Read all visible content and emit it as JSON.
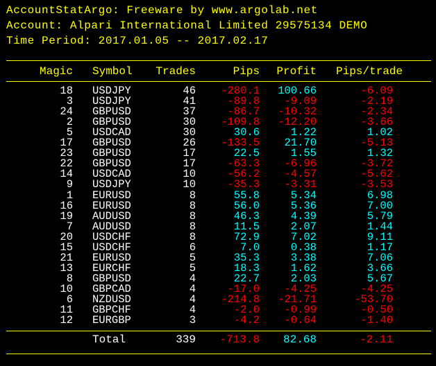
{
  "header": {
    "line1": "AccountStatArgo: Freeware by www.argolab.net",
    "line2": "Account: Alpari International Limited 29575134 DEMO",
    "line3": "Time Period: 2017.01.05 -- 2017.02.17"
  },
  "columns": [
    "Magic",
    "Symbol",
    "Trades",
    "Pips",
    "Profit",
    "Pips/trade"
  ],
  "colors": {
    "background": "#000000",
    "header_text": "#ffff00",
    "table_text": "#ffffff",
    "positive": "#00ffff",
    "negative": "#ff0000"
  },
  "rows": [
    {
      "magic": "18",
      "symbol": "USDJPY",
      "trades": "46",
      "pips": "-280.1",
      "profit": "100.66",
      "pips_per_trade": "-6.09",
      "pips_sign": "neg",
      "profit_sign": "pos",
      "ppt_sign": "neg"
    },
    {
      "magic": "3",
      "symbol": "USDJPY",
      "trades": "41",
      "pips": "-89.8",
      "profit": "-9.09",
      "pips_per_trade": "-2.19",
      "pips_sign": "neg",
      "profit_sign": "neg",
      "ppt_sign": "neg"
    },
    {
      "magic": "24",
      "symbol": "GBPUSD",
      "trades": "37",
      "pips": "-86.7",
      "profit": "-10.32",
      "pips_per_trade": "-2.34",
      "pips_sign": "neg",
      "profit_sign": "neg",
      "ppt_sign": "neg"
    },
    {
      "magic": "2",
      "symbol": "GBPUSD",
      "trades": "30",
      "pips": "-109.8",
      "profit": "-12.20",
      "pips_per_trade": "-3.66",
      "pips_sign": "neg",
      "profit_sign": "neg",
      "ppt_sign": "neg"
    },
    {
      "magic": "5",
      "symbol": "USDCAD",
      "trades": "30",
      "pips": "30.6",
      "profit": "1.22",
      "pips_per_trade": "1.02",
      "pips_sign": "pos",
      "profit_sign": "pos",
      "ppt_sign": "pos"
    },
    {
      "magic": "17",
      "symbol": "GBPUSD",
      "trades": "26",
      "pips": "-133.5",
      "profit": "21.70",
      "pips_per_trade": "-5.13",
      "pips_sign": "neg",
      "profit_sign": "pos",
      "ppt_sign": "neg"
    },
    {
      "magic": "23",
      "symbol": "GBPUSD",
      "trades": "17",
      "pips": "22.5",
      "profit": "1.55",
      "pips_per_trade": "1.32",
      "pips_sign": "pos",
      "profit_sign": "pos",
      "ppt_sign": "pos"
    },
    {
      "magic": "22",
      "symbol": "GBPUSD",
      "trades": "17",
      "pips": "-63.3",
      "profit": "-6.96",
      "pips_per_trade": "-3.72",
      "pips_sign": "neg",
      "profit_sign": "neg",
      "ppt_sign": "neg"
    },
    {
      "magic": "14",
      "symbol": "USDCAD",
      "trades": "10",
      "pips": "-56.2",
      "profit": "-4.57",
      "pips_per_trade": "-5.62",
      "pips_sign": "neg",
      "profit_sign": "neg",
      "ppt_sign": "neg"
    },
    {
      "magic": "9",
      "symbol": "USDJPY",
      "trades": "10",
      "pips": "-35.3",
      "profit": "-3.31",
      "pips_per_trade": "-3.53",
      "pips_sign": "neg",
      "profit_sign": "neg",
      "ppt_sign": "neg"
    },
    {
      "magic": "1",
      "symbol": "EURUSD",
      "trades": "8",
      "pips": "55.8",
      "profit": "5.34",
      "pips_per_trade": "6.98",
      "pips_sign": "pos",
      "profit_sign": "pos",
      "ppt_sign": "pos"
    },
    {
      "magic": "16",
      "symbol": "EURUSD",
      "trades": "8",
      "pips": "56.0",
      "profit": "5.36",
      "pips_per_trade": "7.00",
      "pips_sign": "pos",
      "profit_sign": "pos",
      "ppt_sign": "pos"
    },
    {
      "magic": "19",
      "symbol": "AUDUSD",
      "trades": "8",
      "pips": "46.3",
      "profit": "4.39",
      "pips_per_trade": "5.79",
      "pips_sign": "pos",
      "profit_sign": "pos",
      "ppt_sign": "pos"
    },
    {
      "magic": "7",
      "symbol": "AUDUSD",
      "trades": "8",
      "pips": "11.5",
      "profit": "2.07",
      "pips_per_trade": "1.44",
      "pips_sign": "pos",
      "profit_sign": "pos",
      "ppt_sign": "pos"
    },
    {
      "magic": "20",
      "symbol": "USDCHF",
      "trades": "8",
      "pips": "72.9",
      "profit": "7.02",
      "pips_per_trade": "9.11",
      "pips_sign": "pos",
      "profit_sign": "pos",
      "ppt_sign": "pos"
    },
    {
      "magic": "15",
      "symbol": "USDCHF",
      "trades": "6",
      "pips": "7.0",
      "profit": "0.38",
      "pips_per_trade": "1.17",
      "pips_sign": "pos",
      "profit_sign": "pos",
      "ppt_sign": "pos"
    },
    {
      "magic": "21",
      "symbol": "EURUSD",
      "trades": "5",
      "pips": "35.3",
      "profit": "3.38",
      "pips_per_trade": "7.06",
      "pips_sign": "pos",
      "profit_sign": "pos",
      "ppt_sign": "pos"
    },
    {
      "magic": "13",
      "symbol": "EURCHF",
      "trades": "5",
      "pips": "18.3",
      "profit": "1.62",
      "pips_per_trade": "3.66",
      "pips_sign": "pos",
      "profit_sign": "pos",
      "ppt_sign": "pos"
    },
    {
      "magic": "8",
      "symbol": "GBPUSD",
      "trades": "4",
      "pips": "22.7",
      "profit": "2.03",
      "pips_per_trade": "5.67",
      "pips_sign": "pos",
      "profit_sign": "pos",
      "ppt_sign": "pos"
    },
    {
      "magic": "10",
      "symbol": "GBPCAD",
      "trades": "4",
      "pips": "-17.0",
      "profit": "-4.25",
      "pips_per_trade": "-4.25",
      "pips_sign": "neg",
      "profit_sign": "neg",
      "ppt_sign": "neg"
    },
    {
      "magic": "6",
      "symbol": "NZDUSD",
      "trades": "4",
      "pips": "-214.8",
      "profit": "-21.71",
      "pips_per_trade": "-53.70",
      "pips_sign": "neg",
      "profit_sign": "neg",
      "ppt_sign": "neg"
    },
    {
      "magic": "11",
      "symbol": "GBPCHF",
      "trades": "4",
      "pips": "-2.0",
      "profit": "-0.99",
      "pips_per_trade": "-0.50",
      "pips_sign": "neg",
      "profit_sign": "neg",
      "ppt_sign": "neg"
    },
    {
      "magic": "12",
      "symbol": "EURGBP",
      "trades": "3",
      "pips": "-4.2",
      "profit": "-0.64",
      "pips_per_trade": "-1.40",
      "pips_sign": "neg",
      "profit_sign": "neg",
      "ppt_sign": "neg"
    }
  ],
  "total": {
    "label": "Total",
    "trades": "339",
    "pips": "-713.8",
    "profit": "82.68",
    "pips_per_trade": "-2.11",
    "pips_sign": "neg",
    "profit_sign": "pos",
    "ppt_sign": "neg"
  }
}
